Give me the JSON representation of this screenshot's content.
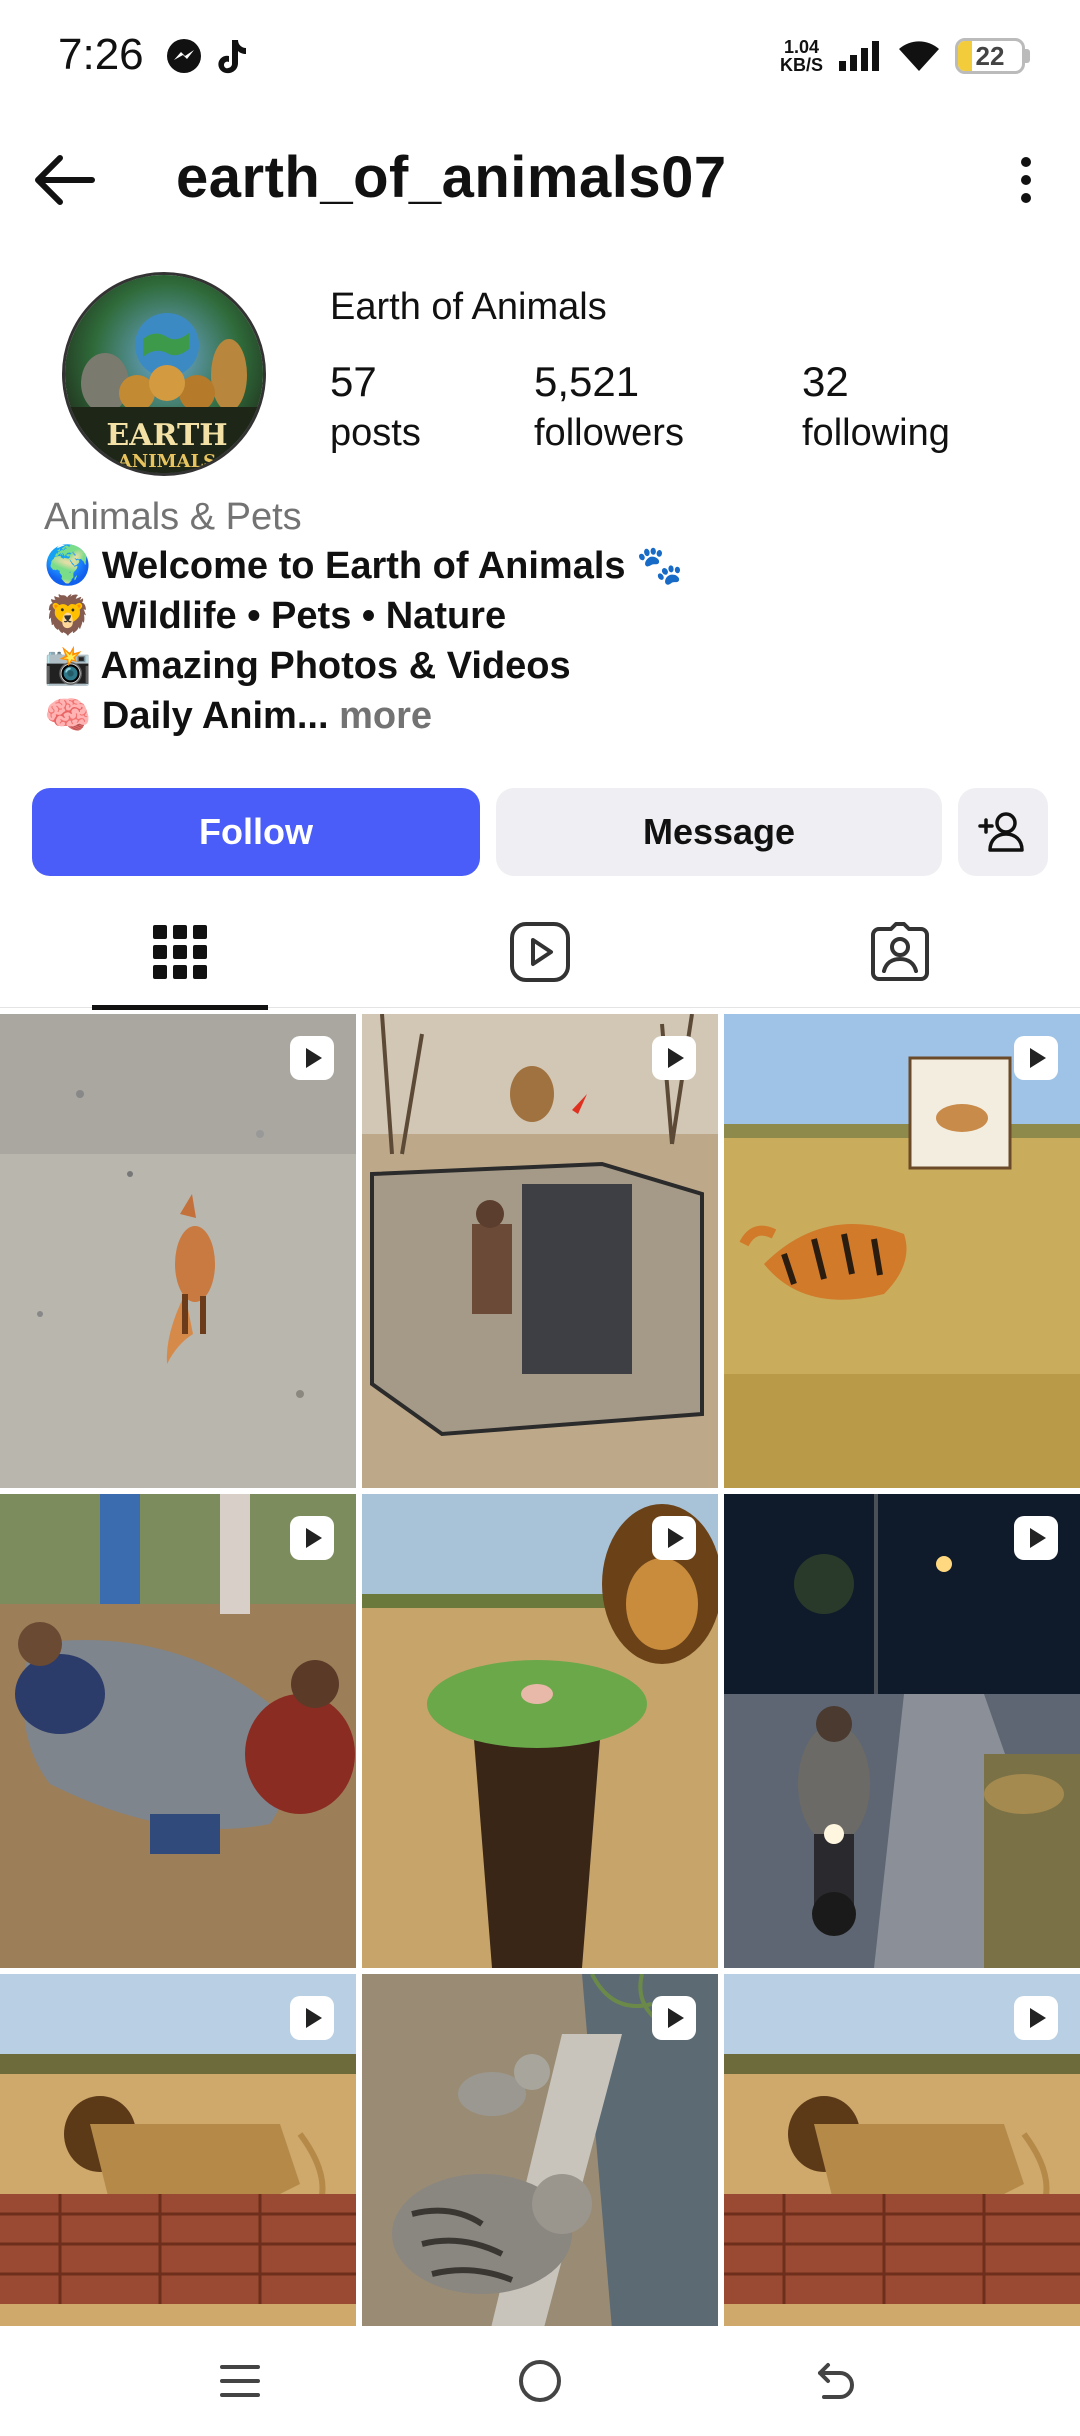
{
  "status_bar": {
    "time": "7:26",
    "net_speed_value": "1.04",
    "net_speed_unit": "KB/S",
    "battery": "22"
  },
  "header": {
    "username": "earth_of_animals07"
  },
  "profile": {
    "display_name": "Earth of Animals",
    "stats": [
      {
        "value": "57",
        "label": "posts"
      },
      {
        "value": "5,521",
        "label": "followers"
      },
      {
        "value": "32",
        "label": "following"
      }
    ],
    "category": "Animals & Pets",
    "bio": [
      "🌍 Welcome to Earth of Animals 🐾",
      "🦁 Wildlife • Pets • Nature",
      "📸 Amazing Photos & Videos",
      "🧠 Daily Anim..."
    ],
    "bio_more": "more",
    "avatar_text": "EARTH",
    "avatar_subtext": "ANIMALS"
  },
  "actions": {
    "follow": "Follow",
    "message": "Message"
  },
  "tabs": [
    "grid-icon",
    "reels-icon",
    "tagged-icon"
  ],
  "posts": [
    {
      "name": "post-fox-beach",
      "type": "reel"
    },
    {
      "name": "post-lion-cage",
      "type": "reel"
    },
    {
      "name": "post-tiger-antelope",
      "type": "reel"
    },
    {
      "name": "post-catfish-people",
      "type": "reel"
    },
    {
      "name": "post-lion-pit",
      "type": "reel"
    },
    {
      "name": "post-motorbike-leopard",
      "type": "reel"
    },
    {
      "name": "post-lion-rocks",
      "type": "reel"
    },
    {
      "name": "post-cats-wall",
      "type": "reel"
    },
    {
      "name": "post-lion-rocks-2",
      "type": "reel"
    }
  ],
  "colors": {
    "follow_button": "#4a5df9",
    "secondary_button": "#efeff3",
    "muted_text": "#737373"
  }
}
